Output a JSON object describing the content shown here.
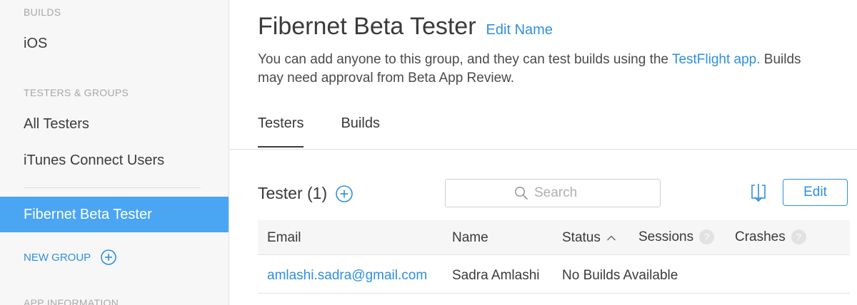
{
  "sidebar": {
    "builds_header": "BUILDS",
    "builds_items": [
      "iOS"
    ],
    "testers_header": "TESTERS & GROUPS",
    "testers_items": [
      "All Testers",
      "iTunes Connect Users"
    ],
    "active_group": "Fibernet Beta Tester",
    "new_group_label": "NEW GROUP",
    "app_info_header": "APP INFORMATION"
  },
  "header": {
    "title": "Fibernet Beta Tester",
    "edit_name": "Edit Name",
    "description_pre": "You can add anyone to this group, and they can test builds using the ",
    "description_link": "TestFlight app.",
    "description_post": " Builds may need approval from Beta App Review."
  },
  "tabs": [
    {
      "label": "Testers",
      "active": true
    },
    {
      "label": "Builds",
      "active": false
    }
  ],
  "testers": {
    "title": "Tester (1)",
    "search_placeholder": "Search",
    "edit_label": "Edit",
    "columns": {
      "email": "Email",
      "name": "Name",
      "status": "Status",
      "sessions": "Sessions",
      "crashes": "Crashes",
      "help_glyph": "?"
    },
    "rows": [
      {
        "email": "amlashi.sadra@gmail.com",
        "name": "Sadra Amlashi",
        "status": "No Builds Available"
      }
    ]
  },
  "colors": {
    "accent": "#2e8fe0",
    "active_sidebar": "#4aa6f2"
  }
}
